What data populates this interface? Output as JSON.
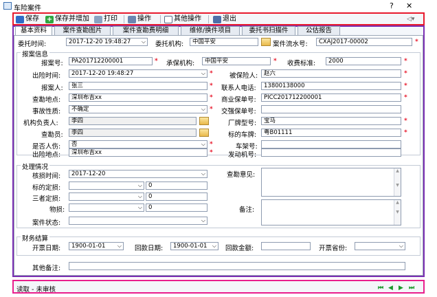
{
  "window": {
    "title": "车险案件",
    "help": "?",
    "close": "✕"
  },
  "toolbar": {
    "save": "保存",
    "save_add": "保存并增加",
    "print": "打印",
    "operate": "操作",
    "other_ops": "其他操作",
    "exit": "退出"
  },
  "tabs": [
    "基本资料",
    "案件查勘图片",
    "案件查勘费明细",
    "维修/换件项目",
    "委托书扫描件",
    "公估报告"
  ],
  "header": {
    "commission_time_label": "委托时间:",
    "commission_time": "2017-12-20 19:48:27",
    "agency_label": "委托机构:",
    "agency": "中国平安",
    "serial_label": "案件流水号:",
    "serial": "CXAJ2017-00002"
  },
  "report": {
    "section": "报案信息",
    "report_no_label": "报案号:",
    "report_no": "PA201712200001",
    "insurer_label": "承保机构:",
    "insurer": "中国平安",
    "fee_label": "收费标准:",
    "fee": "2000",
    "accident_time_label": "出险时间:",
    "accident_time": "2017-12-20 19:48:27",
    "insured_label": "被保险人:",
    "insured": "赵六",
    "reporter_label": "报案人:",
    "reporter": "张三",
    "phone_label": "联系人电话:",
    "phone": "13800138000",
    "survey_place_label": "查勘地点:",
    "survey_place": "深圳布吉xx",
    "commercial_policy_label": "商业保单号:",
    "commercial_policy": "PICC201712200001",
    "nature_label": "事故性质:",
    "nature": "不确定",
    "compulsory_policy_label": "交强保单号:",
    "compulsory_policy": "",
    "org_head_label": "机构负责人:",
    "org_head": "李四",
    "brand_label": "厂牌型号:",
    "brand": "宝马",
    "surveyor_label": "查勘员:",
    "surveyor": "李四",
    "plate_label": "标的车牌:",
    "plate": "粤B01111",
    "injury_label": "是否人伤:",
    "injury": "否",
    "frame_no_label": "车架号:",
    "frame_no": "",
    "accident_place_label": "出险地点:",
    "accident_place": "深圳布吉xx",
    "engine_no_label": "发动机号:",
    "engine_no": ""
  },
  "process": {
    "section": "处理情况",
    "loss_time_label": "核损时间:",
    "loss_time": "2017-12-20",
    "target_loss_label": "标的定损:",
    "target_loss": "0",
    "third_loss_label": "三者定损:",
    "third_loss": "0",
    "property_loss_label": "物损:",
    "property_loss": "0",
    "status_label": "案件状态:",
    "status": "",
    "survey_opinion_label": "查勘意见:",
    "remark_label": "备注:"
  },
  "finance": {
    "section": "财务结算",
    "invoice_date_label": "开票日期:",
    "invoice_date": "1900-01-01",
    "receipt_date_label": "回款日期:",
    "receipt_date": "1900-01-01",
    "receipt_amount_label": "回款金额:",
    "receipt_amount": "",
    "invoice_province_label": "开票省份:",
    "invoice_province": ""
  },
  "other_remark_label": "其他备注:",
  "status_bar": {
    "text": "读取 - 未审核"
  },
  "colors": {
    "toolbar_border": "#e8192c",
    "frame_border": "#7b2fb3",
    "status_border": "#e91e8c",
    "required": "#e8192c",
    "nav": "#1a9a2a"
  }
}
